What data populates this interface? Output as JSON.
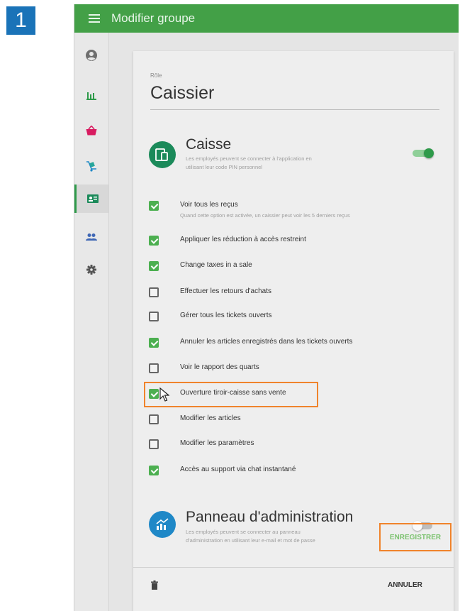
{
  "step_number": "1",
  "header": {
    "title": "Modifier groupe"
  },
  "sidebar": {
    "items": [
      {
        "icon": "account-icon",
        "active": false
      },
      {
        "icon": "bar-chart-icon",
        "active": false
      },
      {
        "icon": "basket-icon",
        "active": false
      },
      {
        "icon": "hand-truck-icon",
        "active": false
      },
      {
        "icon": "id-card-icon",
        "active": true
      },
      {
        "icon": "people-icon",
        "active": false
      },
      {
        "icon": "settings-icon",
        "active": false
      }
    ]
  },
  "role": {
    "label": "Rôle",
    "value": "Caissier"
  },
  "caisse": {
    "title": "Caisse",
    "description_line1": "Les employés peuvent se connecter à l'application en",
    "description_line2": "utilisant leur code PIN personnel",
    "enabled": true,
    "permissions": [
      {
        "label": "Voir tous les reçus",
        "description": "Quand cette option est activée, un caissier peut voir les 5 derniers reçus",
        "checked": true
      },
      {
        "label": "Appliquer les réduction à accès restreint",
        "checked": true
      },
      {
        "label": "Change taxes in a sale",
        "checked": true
      },
      {
        "label": "Effectuer les retours d'achats",
        "checked": false
      },
      {
        "label": "Gérer tous les tickets ouverts",
        "checked": false
      },
      {
        "label": "Annuler les articles enregistrés dans les tickets ouverts",
        "checked": true
      },
      {
        "label": "Voir le rapport des quarts",
        "checked": false
      },
      {
        "label": "Ouverture tiroir-caisse sans vente",
        "checked": true,
        "highlighted": true
      },
      {
        "label": "Modifier les articles",
        "checked": false
      },
      {
        "label": "Modifier les paramètres",
        "checked": false
      },
      {
        "label": "Accès au support via chat instantané",
        "checked": true
      }
    ]
  },
  "admin_panel": {
    "title": "Panneau d'administration",
    "description_line1": "Les employés peuvent se connecter au panneau",
    "description_line2": "d'administration en utilisant leur e-mail et mot de passe",
    "enabled": false
  },
  "footer": {
    "cancel_label": "ANNULER",
    "save_label": "ENREGISTRER"
  },
  "colors": {
    "toolbar": "#43a047",
    "accent_green": "#4caf50",
    "highlight_orange": "#f0832b",
    "step_badge": "#1a73b8",
    "caisse_icon_bg": "#1b8a5a",
    "admin_icon_bg": "#1f88c7"
  }
}
